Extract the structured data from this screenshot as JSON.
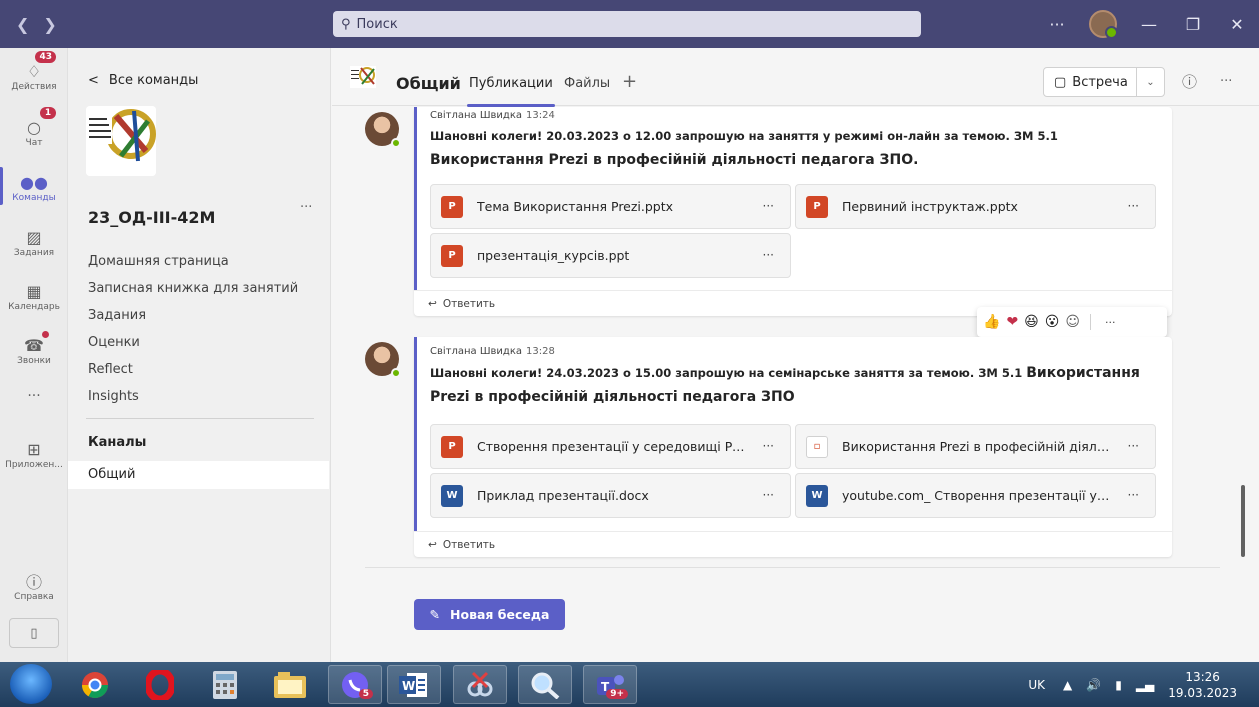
{
  "titlebar": {
    "search_placeholder": "Поиск",
    "more": "···"
  },
  "rail": {
    "items": [
      {
        "label": "Действия",
        "badge": "43"
      },
      {
        "label": "Чат",
        "badge": "1"
      },
      {
        "label": "Команды",
        "active": true
      },
      {
        "label": "Задания"
      },
      {
        "label": "Календарь"
      },
      {
        "label": "Звонки"
      },
      {
        "label": "···"
      },
      {
        "label": "Приложен..."
      },
      {
        "label": "Справка"
      }
    ]
  },
  "team": {
    "back_label": "Все команды",
    "name": "23_ОД-ІІІ-42М",
    "more": "···",
    "links": [
      "Домашняя страница",
      "Записная книжка для занятий",
      "Задания",
      "Оценки",
      "Reflect",
      "Insights"
    ],
    "channels_header": "Каналы",
    "channels": [
      "Общий"
    ]
  },
  "channel": {
    "title": "Общий",
    "tabs": [
      "Публикации",
      "Файлы"
    ],
    "plus": "+",
    "meet_label": "Встреча",
    "more": "···"
  },
  "posts": [
    {
      "author": "Світлана Швидка",
      "time": "13:24",
      "line1": "Шановні колеги! 20.03.2023 о 12.00 запрошую на заняття у режимі он-лайн за темою. ЗМ 5.1",
      "line2": "Використання Prezi в професійній діяльності педагога ЗПО.",
      "attachments": [
        {
          "name": "Тема Використання Prezi.pptx",
          "type": "ppt"
        },
        {
          "name": "Первиний інструктаж.pptx",
          "type": "ppt"
        },
        {
          "name": "презентація_курсів.ppt",
          "type": "ppt"
        }
      ],
      "reply": "Ответить"
    },
    {
      "author": "Світлана Швидка",
      "time": "13:28",
      "line1_a": "Шановні колеги! 24.03.2023 о 15.00 запрошую на семінарське заняття за темою. ЗМ 5.1 ",
      "line1_b": "Використання",
      "line2": "Prezi в професійній діяльності педагога ЗПО",
      "attachments": [
        {
          "name": "Створення презентації у середовищі Pre...",
          "type": "ppt"
        },
        {
          "name": "Використання Prezi в професійній діяльн...",
          "type": "file"
        },
        {
          "name": "Приклад презентації.docx",
          "type": "doc"
        },
        {
          "name": "youtube.com_ Створення презентації у Pr...",
          "type": "doc"
        }
      ],
      "reply": "Ответить"
    }
  ],
  "reactions": [
    "👍",
    "❤",
    "😆",
    "😮",
    "☺"
  ],
  "new_conversation": "Новая беседа",
  "taskbar": {
    "apps": [
      "chrome",
      "opera",
      "calculator",
      "explorer",
      "viber",
      "word",
      "snipping",
      "search",
      "teams"
    ],
    "viber_badge": "5",
    "teams_badge": "9+",
    "lang": "UK",
    "time": "13:26",
    "date": "19.03.2023"
  },
  "colors": {
    "accent": "#5b5fc7",
    "titlebar": "#464775",
    "badge": "#c4314b"
  }
}
